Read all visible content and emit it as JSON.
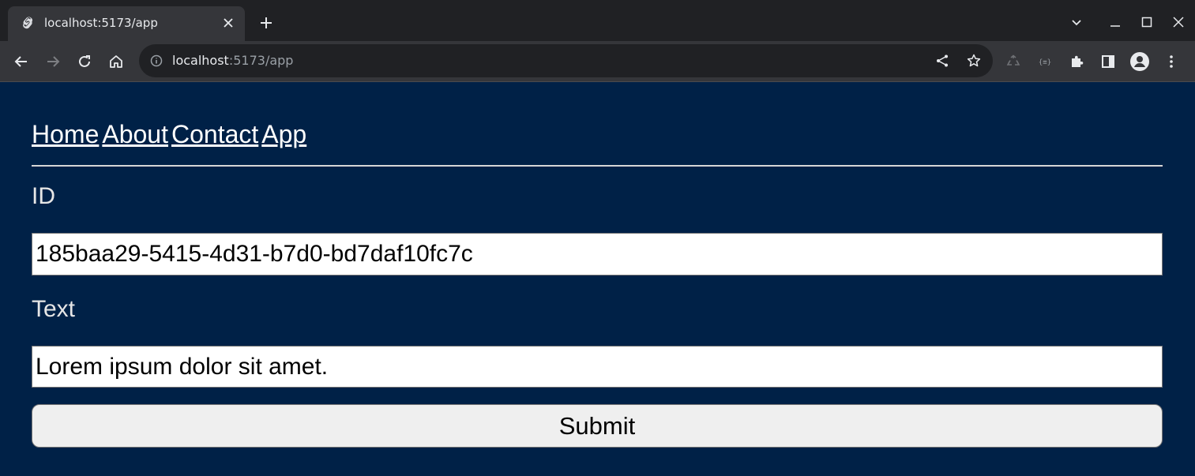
{
  "browser": {
    "tab_title": "localhost:5173/app",
    "url_host": "localhost",
    "url_rest": ":5173/app"
  },
  "nav": {
    "links": [
      "Home",
      "About",
      "Contact",
      "App"
    ]
  },
  "form": {
    "id_label": "ID",
    "id_value": "185baa29-5415-4d31-b7d0-bd7daf10fc7c",
    "text_label": "Text",
    "text_value": "Lorem ipsum dolor sit amet.",
    "submit_label": "Submit"
  },
  "colors": {
    "page_background": "#002147",
    "chrome_dark": "#202124",
    "chrome_toolbar": "#35363a"
  }
}
